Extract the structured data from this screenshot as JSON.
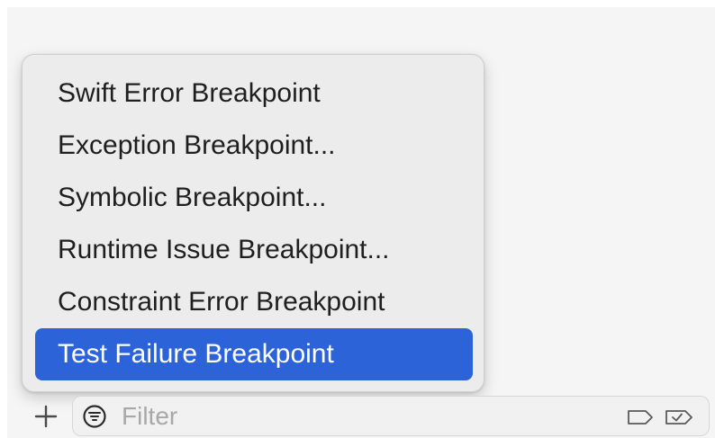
{
  "menu": {
    "items": [
      {
        "label": "Swift Error Breakpoint",
        "selected": false
      },
      {
        "label": "Exception Breakpoint...",
        "selected": false
      },
      {
        "label": "Symbolic Breakpoint...",
        "selected": false
      },
      {
        "label": "Runtime Issue Breakpoint...",
        "selected": false
      },
      {
        "label": "Constraint Error Breakpoint",
        "selected": false
      },
      {
        "label": "Test Failure Breakpoint",
        "selected": true
      }
    ]
  },
  "bottom_bar": {
    "add_icon": "plus-icon",
    "filter": {
      "icon": "filter-circle-icon",
      "placeholder": "Filter",
      "value": ""
    },
    "scope_icons": [
      "tag-icon",
      "checked-tag-icon"
    ]
  },
  "colors": {
    "selection": "#2c63d9",
    "menu_background": "#ececec",
    "pane_background": "#f5f5f5"
  }
}
